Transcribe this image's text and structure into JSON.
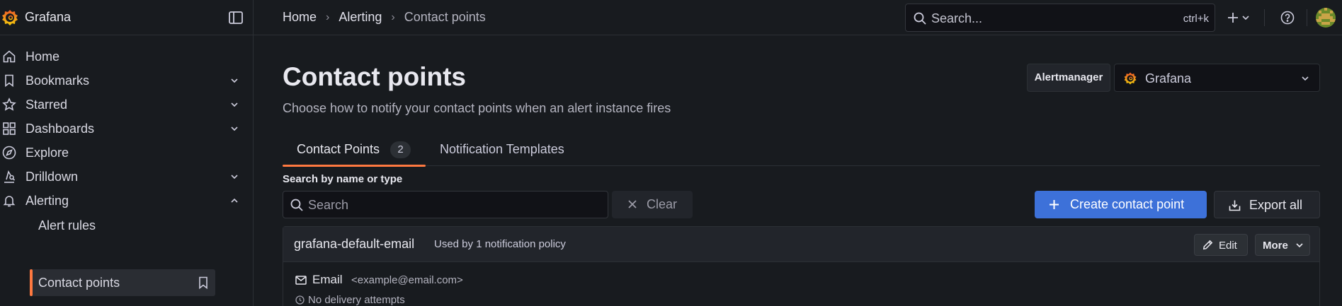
{
  "app": {
    "name": "Grafana"
  },
  "breadcrumb": {
    "items": [
      "Home",
      "Alerting"
    ],
    "separator": "›",
    "current": "Contact points"
  },
  "search": {
    "placeholder": "Search...",
    "shortcut": "ctrl+k"
  },
  "sidebar": {
    "items": [
      {
        "label": "Home",
        "icon": "home-icon"
      },
      {
        "label": "Bookmarks",
        "icon": "bookmark-icon",
        "expandable": true
      },
      {
        "label": "Starred",
        "icon": "star-icon",
        "expandable": true
      },
      {
        "label": "Dashboards",
        "icon": "apps-icon",
        "expandable": true
      },
      {
        "label": "Explore",
        "icon": "compass-icon"
      },
      {
        "label": "Drilldown",
        "icon": "drilldown-icon",
        "expandable": true
      },
      {
        "label": "Alerting",
        "icon": "bell-icon",
        "expanded": true
      }
    ],
    "subitems": [
      {
        "label": "Alert rules"
      },
      {
        "label": "Contact points",
        "active": true
      }
    ]
  },
  "page": {
    "title": "Contact points",
    "subtitle": "Choose how to notify your contact points when an alert instance fires"
  },
  "alertmanager": {
    "label": "Alertmanager",
    "value": "Grafana"
  },
  "tabs": [
    {
      "label": "Contact Points",
      "count": "2",
      "active": true
    },
    {
      "label": "Notification Templates"
    }
  ],
  "filter": {
    "label": "Search by name or type",
    "placeholder": "Search",
    "clear_label": "Clear"
  },
  "actions": {
    "create_label": "Create contact point",
    "export_label": "Export all"
  },
  "contact_points": [
    {
      "name": "grafana-default-email",
      "usage": "Used by 1 notification policy",
      "edit_label": "Edit",
      "more_label": "More",
      "integration": {
        "type": "Email",
        "address": "<example@email.com>",
        "status": "No delivery attempts"
      }
    }
  ],
  "colors": {
    "accent": "#ff7940",
    "primary": "#3d71d9",
    "background": "#181b1f"
  }
}
